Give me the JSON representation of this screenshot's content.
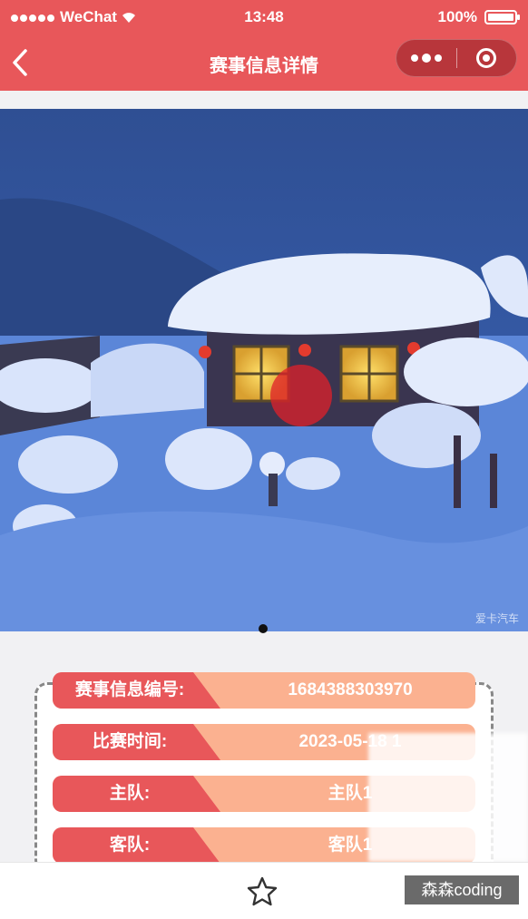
{
  "status_bar": {
    "carrier": "WeChat",
    "time": "13:48",
    "battery_text": "100%",
    "battery_level": 1.0
  },
  "nav": {
    "title": "赛事信息详情",
    "back_icon": "chevron-left-icon",
    "more_icon": "more-dots-icon",
    "close_icon": "target-circle-icon"
  },
  "banner": {
    "image_watermark": "爱卡汽车",
    "indicator_count": 1,
    "active_index": 0
  },
  "details": [
    {
      "label": "赛事信息编号:",
      "value": "1684388303970"
    },
    {
      "label": "比赛时间:",
      "value": "2023-05-18 1"
    },
    {
      "label": "主队:",
      "value": "主队1"
    },
    {
      "label": "客队:",
      "value": "客队1"
    }
  ],
  "bottom_bar": {
    "favorite_icon": "star-outline-icon"
  },
  "overlay": {
    "corner_watermark": "森森coding"
  },
  "colors": {
    "header": "#e8575a",
    "label_bg": "#e8575a",
    "value_bg": "#fbb190"
  }
}
